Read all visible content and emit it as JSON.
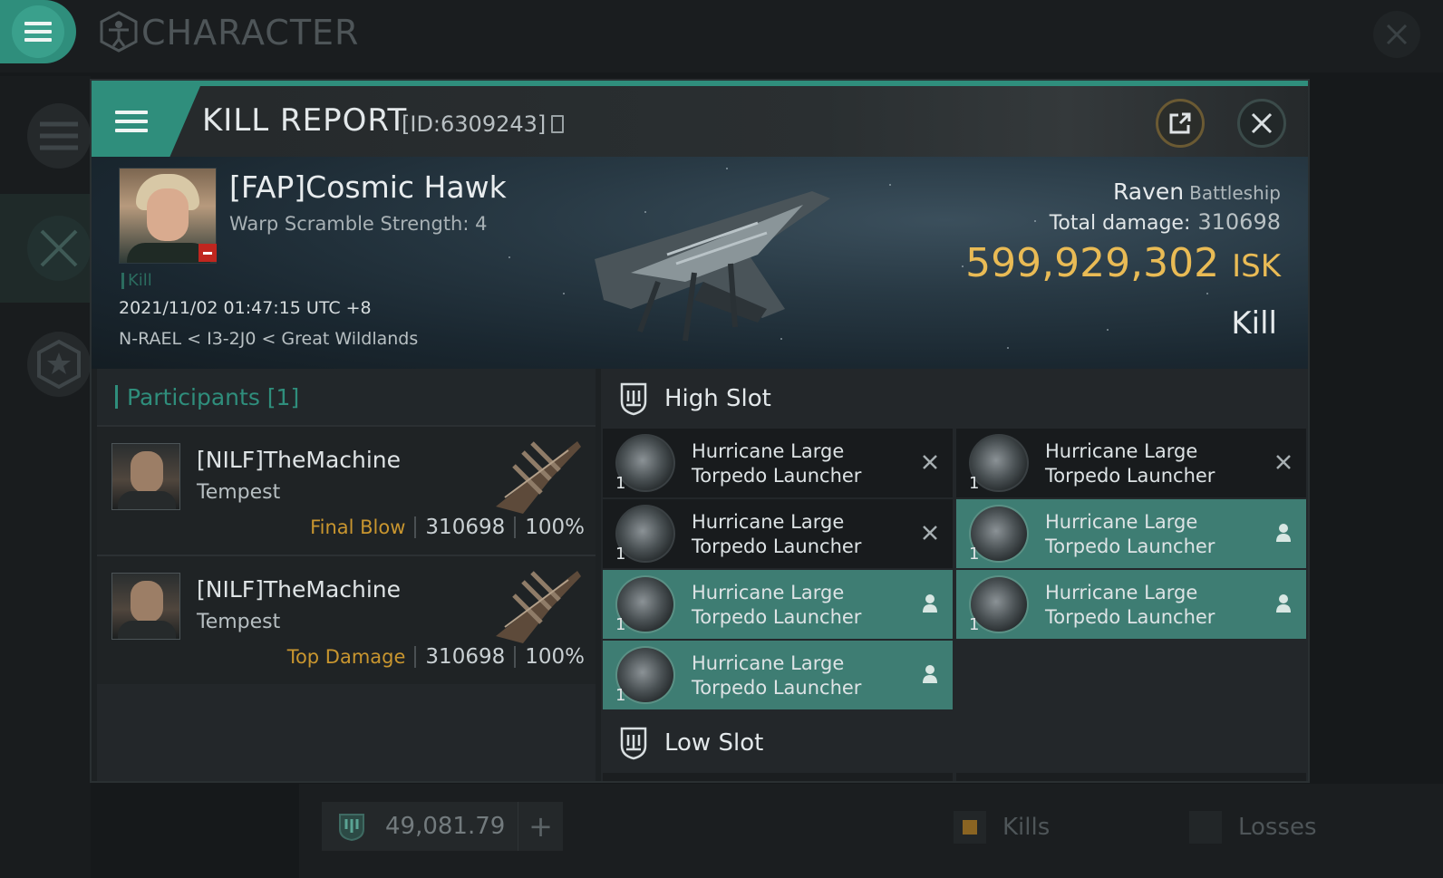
{
  "app": {
    "title": "CHARACTER"
  },
  "bottom_bar": {
    "isk_value": "49,081.79",
    "kills_label": "Kills",
    "losses_label": "Losses"
  },
  "kill_report": {
    "title": "KILL REPORT",
    "id_text": "[ID:6309243]",
    "victim": {
      "name": "[FAP]Cosmic Hawk",
      "warp_scramble": "Warp Scramble Strength: 4",
      "kill_tag": "Kill",
      "datetime": "2021/11/02 01:47:15 UTC +8",
      "location": "N-RAEL < I3-2J0 < Great Wildlands",
      "ship_name": "Raven",
      "ship_class": "Battleship",
      "total_damage_label": "Total damage:",
      "total_damage": "310698",
      "isk_value": "599,929,302",
      "isk_unit": "ISK",
      "result": "Kill"
    },
    "participants": {
      "header": "Participants [1]",
      "rows": [
        {
          "name": "[NILF]TheMachine",
          "ship": "Tempest",
          "tag": "Final Blow",
          "damage": "310698",
          "percent": "100%"
        },
        {
          "name": "[NILF]TheMachine",
          "ship": "Tempest",
          "tag": "Top Damage",
          "damage": "310698",
          "percent": "100%"
        }
      ]
    },
    "high_slot": {
      "label": "High Slot",
      "items": [
        {
          "line1": "Hurricane Large",
          "line2": "Torpedo Launcher",
          "qty": "1",
          "state": "destroyed"
        },
        {
          "line1": "Hurricane Large",
          "line2": "Torpedo Launcher",
          "qty": "1",
          "state": "destroyed"
        },
        {
          "line1": "Hurricane Large",
          "line2": "Torpedo Launcher",
          "qty": "1",
          "state": "destroyed"
        },
        {
          "line1": "Hurricane Large",
          "line2": "Torpedo Launcher",
          "qty": "1",
          "state": "dropped"
        },
        {
          "line1": "Hurricane Large",
          "line2": "Torpedo Launcher",
          "qty": "1",
          "state": "dropped"
        },
        {
          "line1": "Hurricane Large",
          "line2": "Torpedo Launcher",
          "qty": "1",
          "state": "dropped"
        },
        {
          "line1": "Hurricane Large",
          "line2": "Torpedo Launcher",
          "qty": "1",
          "state": "dropped"
        }
      ]
    },
    "low_slot": {
      "label": "Low Slot"
    }
  },
  "colors": {
    "accent": "#2f8e7c",
    "isk": "#e9bb55",
    "fitted_row": "#3e7d73",
    "final_blow": "#c9962f"
  }
}
